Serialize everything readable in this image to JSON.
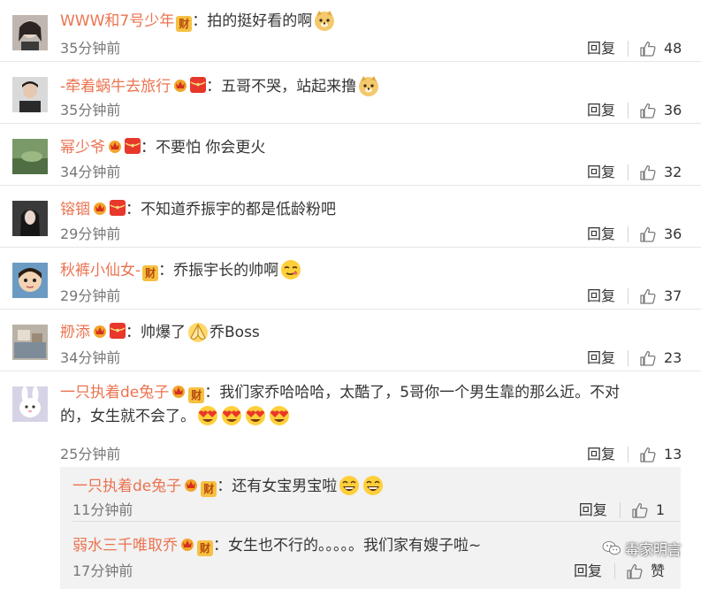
{
  "comments": [
    {
      "user": "WWW和7号少年",
      "text": "：拍的挺好看的啊",
      "emoji": "doge",
      "time": "35分钟前",
      "reply": "回复",
      "likes": "48"
    },
    {
      "user": "-牵着蜗牛去旅行",
      "text": "：五哥不哭，站起来撸",
      "emoji": "doge",
      "time": "35分钟前",
      "reply": "回复",
      "likes": "36"
    },
    {
      "user": "幂少爷",
      "text": "：不要怕 你会更火",
      "time": "34分钟前",
      "reply": "回复",
      "likes": "32"
    },
    {
      "user": "镕锢",
      "text": "：不知道乔振宇的都是低龄粉吧",
      "time": "29分钟前",
      "reply": "回复",
      "likes": "36"
    },
    {
      "user": "秋裤小仙女-",
      "text": "：乔振宇长的帅啊",
      "emoji": "smirk",
      "time": "29分钟前",
      "reply": "回复",
      "likes": "37"
    },
    {
      "user": "剙添",
      "text": "：帅爆了",
      "emoji": "pray",
      "text_after": "乔Boss",
      "time": "34分钟前",
      "reply": "回复",
      "likes": "23"
    },
    {
      "user": "一只执着de兔子",
      "text": "：我们家乔哈哈哈，太酷了，5哥你一个男生靠的那么近。不对",
      "text_line2": "的，女生就不会了。",
      "emoji": "heart-eyes",
      "time": "25分钟前",
      "reply": "回复",
      "likes": "13"
    }
  ],
  "replies": [
    {
      "user": "一只执着de兔子",
      "text": "：还有女宝男宝啦",
      "emoji": "laugh",
      "time": "11分钟前",
      "reply": "回复",
      "likes": "1"
    },
    {
      "user": "弱水三千唯取乔",
      "text": "：女生也不行的。。。。。我们家有嫂子啦~",
      "time": "17分钟前",
      "reply": "回复",
      "likes": "赞"
    }
  ],
  "badges": {
    "cai": "财"
  },
  "watermark": "毒家明言",
  "colors": {
    "username": "#eb7350",
    "reply_bg": "#f2f2f2",
    "time": "#777777"
  }
}
